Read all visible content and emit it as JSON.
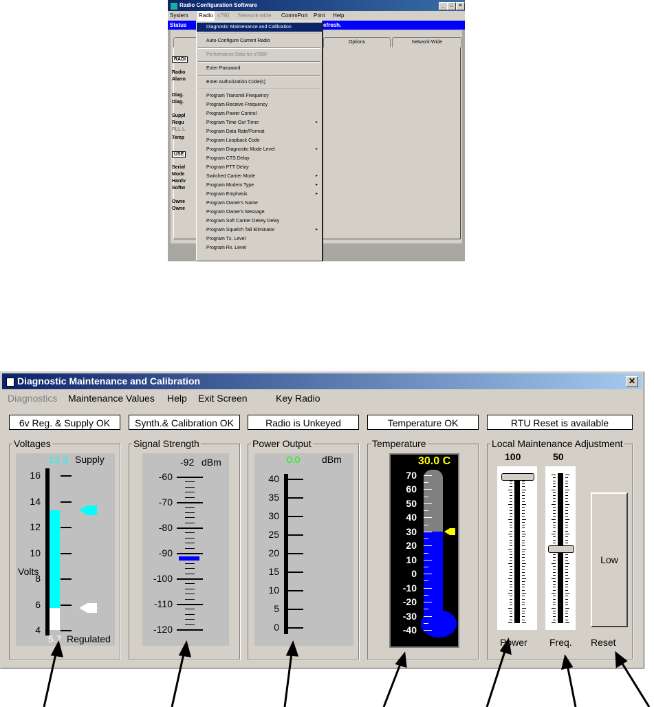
{
  "top_window": {
    "title": "Radio Configuration Software",
    "menu": [
      "System",
      "Radio",
      "x790",
      "Network-wide",
      "CommPort",
      "Print",
      "Help"
    ],
    "status_label": "Status",
    "status_tail": "efresh.",
    "tabs": [
      "Options",
      "Network-Wide"
    ],
    "left_labels": [
      "RADI",
      "Radio",
      "Alarm",
      "Diag.",
      "Diag.",
      "Suppl",
      "Regu",
      "PLL L",
      "Temp",
      "USE",
      "Serial",
      "Mode",
      "Hardv",
      "Softw",
      "Owne",
      "Owne"
    ],
    "dropdown": [
      {
        "label": "Diagnostic Maintenance and Calibration",
        "state": "highlighted"
      },
      {
        "label": "Auto-Configure Current Radio"
      },
      {
        "label": "Performance Data for x7900",
        "state": "disabled"
      },
      {
        "label": "Enter Password"
      },
      {
        "label": "Enter Authorization Code(s)"
      },
      {
        "label": "Program Transmit Frequency"
      },
      {
        "label": "Program Receive Frequency"
      },
      {
        "label": "Program Power Control"
      },
      {
        "label": "Program Time Out Timer",
        "submenu": true
      },
      {
        "label": "Program Data Rate/Format"
      },
      {
        "label": "Program Loopback Code"
      },
      {
        "label": "Program Diagnostic Mode Level",
        "submenu": true
      },
      {
        "label": "Program CTS Delay"
      },
      {
        "label": "Program PTT Delay"
      },
      {
        "label": "Switched Carrier Mode",
        "submenu": true
      },
      {
        "label": "Program Modem Type",
        "submenu": true
      },
      {
        "label": "Program Emphasis",
        "submenu": true
      },
      {
        "label": "Program Owner's Name"
      },
      {
        "label": "Program Owner's Message"
      },
      {
        "label": "Program Soft Carrier Dekey Delay"
      },
      {
        "label": "Program Squelch Tail Eliminator",
        "submenu": true
      },
      {
        "label": "Program Tx. Level"
      },
      {
        "label": "Program Rx. Level"
      }
    ]
  },
  "dialog": {
    "title": "Diagnostic Maintenance and Calibration",
    "close_glyph": "✕",
    "menu": {
      "diagnostics": "Diagnostics",
      "maintenance": "Maintenance Values",
      "help": "Help",
      "exit": "Exit Screen",
      "key_radio": "Key Radio"
    },
    "status_boxes": [
      "6v Reg. & Supply OK",
      "Synth.& Calibration OK",
      "Radio is Unkeyed",
      "Temperature OK",
      "RTU Reset is available"
    ],
    "voltages": {
      "label": "Voltages",
      "supply_value": "13.3",
      "supply_label": "Supply",
      "regulated_value": "5.7",
      "regulated_label": "Regulated",
      "unit_label": "Volts",
      "ticks": [
        "16",
        "14",
        "12",
        "10",
        "8",
        "6",
        "4"
      ],
      "range": [
        4,
        16
      ],
      "supply": 13.3,
      "regulated": 5.7,
      "supply_color": "#00ffff",
      "regulated_color": "#ffffff"
    },
    "signal": {
      "label": "Signal Strength",
      "value": "-92",
      "unit": "dBm",
      "ticks": [
        "-60",
        "-70",
        "-80",
        "-90",
        "-100",
        "-110",
        "-120"
      ],
      "range": [
        -120,
        -60
      ],
      "reading": -92,
      "marker_color": "#0000ff"
    },
    "power": {
      "label": "Power Output",
      "value": "0.0",
      "unit": "dBm",
      "ticks": [
        "40",
        "35",
        "30",
        "25",
        "20",
        "15",
        "10",
        "5",
        "0"
      ],
      "range": [
        0,
        40
      ],
      "reading": 0.0,
      "value_color": "#00ff00"
    },
    "temperature": {
      "label": "Temperature",
      "value": "30.0 C",
      "ticks": [
        "70",
        "60",
        "50",
        "40",
        "30",
        "20",
        "10",
        "0",
        "-10",
        "-20",
        "-30",
        "-40"
      ],
      "range": [
        -40,
        70
      ],
      "reading": 30.0,
      "fill_color": "#0000ff",
      "value_color": "#ffff00"
    },
    "adjust": {
      "label": "Local Maintenance Adjustment",
      "power_value": "100",
      "power_label": "Power",
      "power_level": 100,
      "freq_value": "50",
      "freq_label": "Freq.",
      "freq_level": 50,
      "reset_button": "Low",
      "reset_label": "Reset"
    }
  }
}
